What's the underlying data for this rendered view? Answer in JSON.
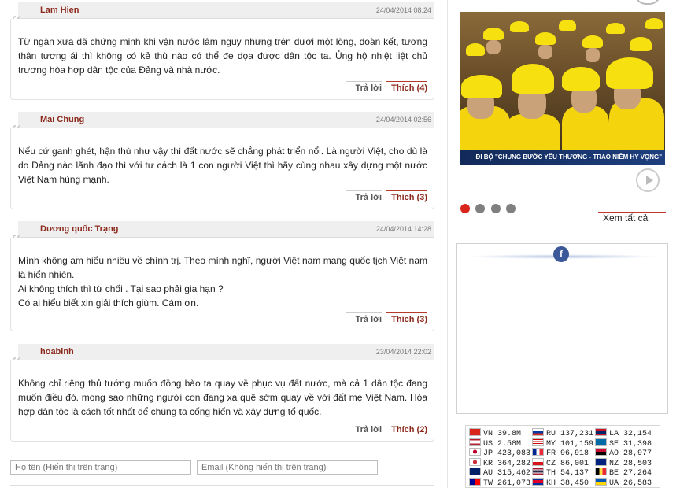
{
  "comments": [
    {
      "author": "Lam Hien",
      "date": "24/04/2014 08:24",
      "text": "Từ ngàn xưa đã chứng minh khi vận nước lâm nguy nhưng trên dưới một lòng, đoàn kết, tương thân tương ái thì không có kẻ thù nào có thể đe dọa được dân tộc ta. Ủng hộ nhiệt liệt chủ trương hòa hợp dân tộc của Đảng và nhà nước.",
      "reply": "Trả lời",
      "like": "Thích",
      "likes": "(4)"
    },
    {
      "author": "Mai Chung",
      "date": "24/04/2014 02:56",
      "text": "Nếu cứ ganh ghét, hận thù như vậy thì đất nước sẽ chẳng phát triển nổi. Là người Việt, cho dù là do Đảng nào lãnh đạo thì với tư cách là 1 con người Việt thì hãy cùng nhau xây dựng một nước Việt Nam hùng mạnh.",
      "reply": "Trả lời",
      "like": "Thích",
      "likes": "(3)"
    },
    {
      "author": "Dương quốc Trạng",
      "date": "24/04/2014 14:28",
      "text": "Mình không am hiểu nhiều về chính trị. Theo mình nghĩ, người Việt nam mang quốc tịch Việt nam là hiển nhiên.\nAi không thích thì từ chối . Tại sao phải gia hạn ?\nCó ai hiểu biết xin giải thích giùm. Cám ơn.",
      "reply": "Trả lời",
      "like": "Thích",
      "likes": "(3)"
    },
    {
      "author": "hoabinh",
      "date": "23/04/2014 22:02",
      "text": "Không chỉ riêng thủ tướng muốn đồng bào ta quay về phục vụ đất nước, mà cả 1 dân tộc đang muốn điều đó. mong sao những người con đang xa quê sớm quay về với đất mẹ Việt Nam. Hòa hợp dân tộc là cách tốt nhất để chúng ta cống hiến và xây dựng tổ quốc.",
      "reply": "Trả lời",
      "like": "Thích",
      "likes": "(2)"
    }
  ],
  "form": {
    "name_placeholder": "Họ tên (Hiển thị trên trang)",
    "email_placeholder": "Email (Không hiển thị trên trang)"
  },
  "video": {
    "caption": "ĐI BỘ \"CHUNG BƯỚC YÊU THƯƠNG - TRAO NIỀM HY VỌNG\""
  },
  "slider": {
    "dot_count": 4,
    "active_index": 0,
    "see_all": "Xem tất cả"
  },
  "facebook": {
    "icon": "f",
    "color": "#3b5998"
  },
  "visitors": [
    [
      {
        "code": "VN",
        "count": "39.8M",
        "flag": "vn"
      },
      {
        "code": "RU",
        "count": "137,231",
        "flag": "ru"
      },
      {
        "code": "LA",
        "count": "32,154",
        "flag": "la"
      }
    ],
    [
      {
        "code": "US",
        "count": "2.58M",
        "flag": "us"
      },
      {
        "code": "MY",
        "count": "101,159",
        "flag": "my"
      },
      {
        "code": "SE",
        "count": "31,398",
        "flag": "se"
      }
    ],
    [
      {
        "code": "JP",
        "count": "423,083",
        "flag": "jp"
      },
      {
        "code": "FR",
        "count": "96,918",
        "flag": "fr"
      },
      {
        "code": "AO",
        "count": "28,977",
        "flag": "ao"
      }
    ],
    [
      {
        "code": "KR",
        "count": "364,282",
        "flag": "kr"
      },
      {
        "code": "CZ",
        "count": "86,001",
        "flag": "cz"
      },
      {
        "code": "NZ",
        "count": "28,503",
        "flag": "nz"
      }
    ],
    [
      {
        "code": "AU",
        "count": "315,462",
        "flag": "au"
      },
      {
        "code": "TH",
        "count": "54,137",
        "flag": "th"
      },
      {
        "code": "BE",
        "count": "27,264",
        "flag": "be"
      }
    ],
    [
      {
        "code": "TW",
        "count": "261,073",
        "flag": "tw"
      },
      {
        "code": "KH",
        "count": "38,450",
        "flag": "kh"
      },
      {
        "code": "UA",
        "count": "26,583",
        "flag": "ua"
      }
    ]
  ],
  "colors": {
    "accent": "#8b2a1c",
    "active_dot": "#d9261c",
    "dot": "#808080"
  }
}
